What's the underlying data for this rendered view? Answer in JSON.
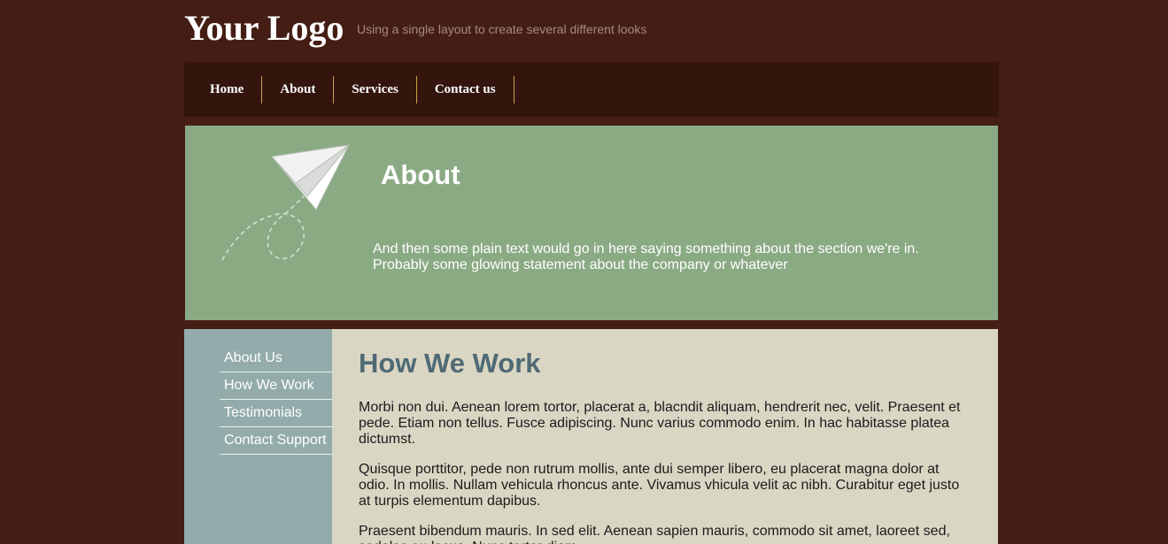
{
  "header": {
    "logo": "Your Logo",
    "tagline": "Using a single layout to create several different looks"
  },
  "nav": {
    "items": [
      {
        "label": "Home"
      },
      {
        "label": "About"
      },
      {
        "label": "Services"
      },
      {
        "label": "Contact us"
      }
    ]
  },
  "hero": {
    "title": "About",
    "text": "And then some plain text would go in here saying something about the section we're in. Probably some glowing statement about the company or whatever",
    "icon": "paper-plane-icon"
  },
  "sidebar": {
    "items": [
      {
        "label": "About Us"
      },
      {
        "label": "How We Work"
      },
      {
        "label": "Testimonials"
      },
      {
        "label": "Contact Support"
      }
    ]
  },
  "main": {
    "title": "How We Work",
    "paragraphs": [
      "Morbi non dui. Aenean lorem tortor, placerat a, blacndit aliquam, hendrerit nec, velit. Praesent et pede. Etiam non tellus. Fusce adipiscing. Nunc varius commodo enim. In hac habitasse platea dictumst.",
      "Quisque porttitor, pede non rutrum mollis, ante dui semper libero, eu placerat magna dolor at odio. In mollis. Nullam vehicula rhoncus ante. Vivamus vhicula velit ac nibh. Curabitur eget justo at turpis elementum dapibus.",
      "Praesent bibendum mauris. In sed elit. Aenean sapien mauris, commodo sit amet, laoreet sed, sodales eu lacus. Nunc tortor diam."
    ]
  },
  "colors": {
    "page_bg": "#441e14",
    "nav_bg": "#34150e",
    "nav_divider": "#c9a24a",
    "hero_bg": "#8aaa84",
    "sidebar_bg": "#93acab",
    "content_bg": "#d9d6c3",
    "heading": "#4f6a74"
  }
}
